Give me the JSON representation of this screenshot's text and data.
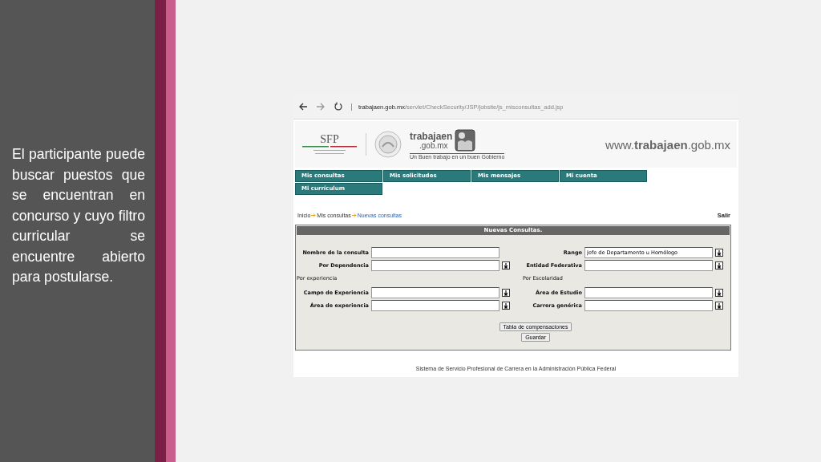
{
  "slide_text": "El participante puede buscar puestos que se encuentran en concurso y cuyo filtro curricular se encuentre abierto para postularse.",
  "browser": {
    "host": "trabajaen.gob.mx",
    "path": "/servlet/CheckSecurity/JSP/jobsite/js_misconsultas_add.jsp"
  },
  "header": {
    "sfp": "SFP",
    "brand_top": "trabajaen",
    "brand_bottom": ".gob.mx",
    "slogan": "Un Buen trabajo en un buen Gobierno",
    "site": "www.**trabajaen**.gob.mx"
  },
  "nav": [
    "Mis consultas",
    "Mis solicitudes",
    "Mis mensajes",
    "Mi cuenta",
    "Mi currículum"
  ],
  "breadcrumb": [
    "Inicio",
    "Mis consultas",
    "Nuevas consultas"
  ],
  "logout": "Salir",
  "form": {
    "title": "Nuevas Consultas.",
    "left": [
      {
        "kind": "text",
        "label": "Nombre de la consulta"
      },
      {
        "kind": "select",
        "label": "Por Dependencia"
      },
      {
        "kind": "section",
        "label": "Por experiencia"
      },
      {
        "kind": "select",
        "label": "Campo de Experiencia"
      },
      {
        "kind": "select",
        "label": "Área de experiencia"
      }
    ],
    "right": [
      {
        "kind": "select",
        "label": "Rango",
        "value": "Jefe de Departamento u Homólogo"
      },
      {
        "kind": "select",
        "label": "Entidad Federativa"
      },
      {
        "kind": "section",
        "label": "Por Escolaridad"
      },
      {
        "kind": "select",
        "label": "Área de Estudio"
      },
      {
        "kind": "select",
        "label": "Carrera genérica"
      }
    ],
    "buttons": [
      "Tabla de compensaciones",
      "Guardar"
    ]
  },
  "footer": "Sistema de Servicio Profesional de Carrera en la Administración Pública Federal"
}
